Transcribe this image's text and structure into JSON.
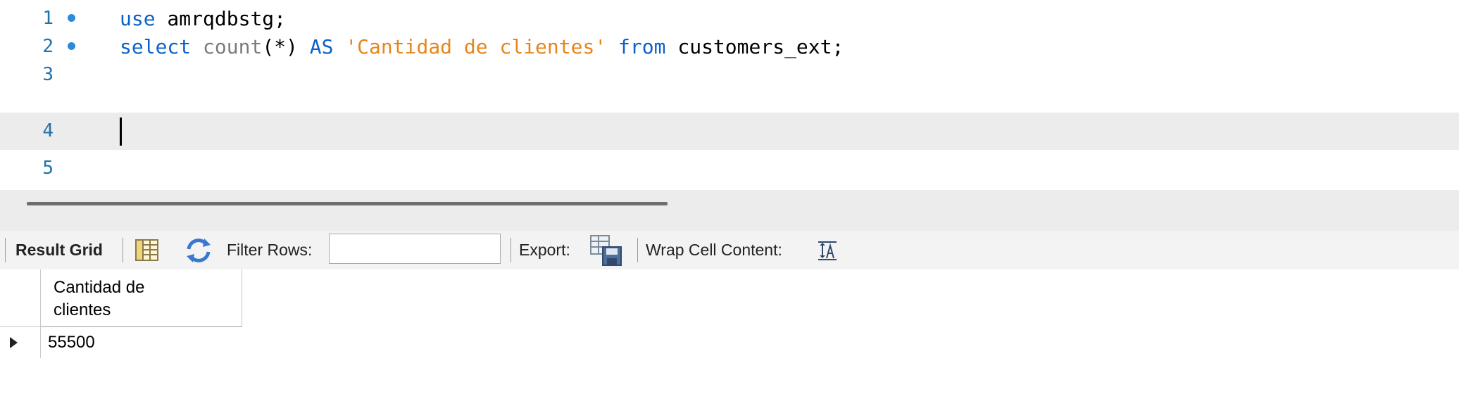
{
  "editor": {
    "lines": [
      {
        "num": "1",
        "has_dot": true
      },
      {
        "num": "2",
        "has_dot": true
      },
      {
        "num": "3",
        "has_dot": false
      },
      {
        "num": "4",
        "has_dot": false
      },
      {
        "num": "5",
        "has_dot": false
      }
    ],
    "line1": {
      "kw_use": "use",
      "db": " amrqdbstg;"
    },
    "line2": {
      "kw_select": "select",
      "fn_count": " count",
      "args": "(*) ",
      "kw_as": "AS",
      "alias": " 'Cantidad de clientes'",
      "kw_from": " from",
      "table": " customers_ext;"
    }
  },
  "toolbar": {
    "result_grid_label": "Result Grid",
    "filter_rows_label": "Filter Rows:",
    "filter_value": "",
    "export_label": "Export:",
    "wrap_label": "Wrap Cell Content:"
  },
  "grid": {
    "columns": [
      {
        "header_line1": "Cantidad de",
        "header_line2": "clientes"
      }
    ],
    "rows": [
      [
        "55500"
      ]
    ]
  },
  "colors": {
    "keyword": "#0b62c7",
    "string": "#e7851b",
    "line_number": "#1f73a8",
    "current_line": "#ececec"
  }
}
